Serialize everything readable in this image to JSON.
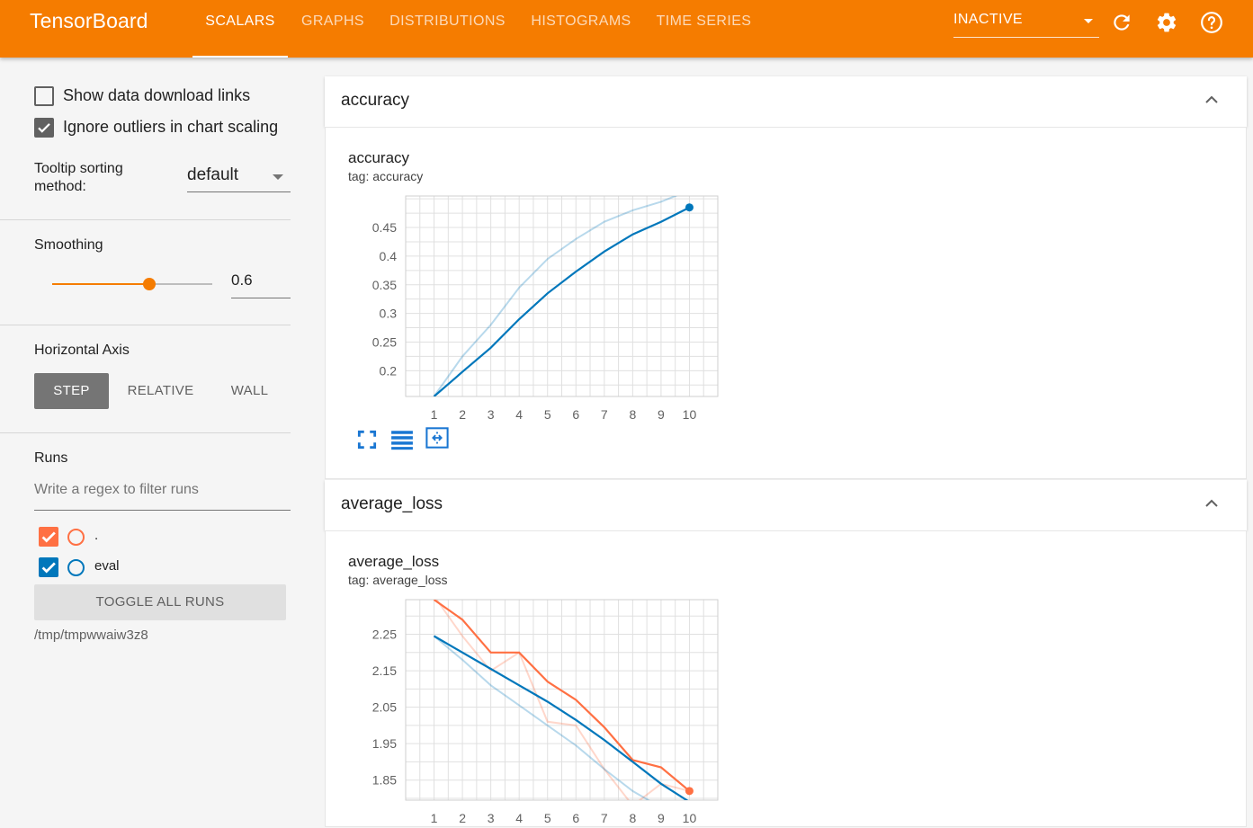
{
  "app": {
    "brand": "TensorBoard",
    "tabs": [
      {
        "label": "SCALARS",
        "active": true
      },
      {
        "label": "GRAPHS",
        "active": false
      },
      {
        "label": "DISTRIBUTIONS",
        "active": false
      },
      {
        "label": "HISTOGRAMS",
        "active": false
      },
      {
        "label": "TIME SERIES",
        "active": false
      }
    ],
    "status": "INACTIVE",
    "icons": [
      "refresh-icon",
      "settings-icon",
      "help-icon"
    ],
    "accent_color": "#f57c00"
  },
  "sidebar": {
    "show_download_links": {
      "label": "Show data download links",
      "checked": false
    },
    "ignore_outliers": {
      "label": "Ignore outliers in chart scaling",
      "checked": true
    },
    "tooltip_sorting": {
      "label": "Tooltip sorting method:",
      "value": "default"
    },
    "smoothing": {
      "label": "Smoothing",
      "value": "0.6",
      "fraction": 0.6
    },
    "horizontal_axis": {
      "label": "Horizontal Axis",
      "options": [
        "STEP",
        "RELATIVE",
        "WALL"
      ],
      "selected": "STEP"
    },
    "runs": {
      "label": "Runs",
      "filter_placeholder": "Write a regex to filter runs",
      "items": [
        {
          "name": ".",
          "checked": true,
          "color": "#ff7043"
        },
        {
          "name": "eval",
          "checked": true,
          "color": "#0077bb"
        }
      ],
      "toggle_all_label": "TOGGLE ALL RUNS",
      "logdir": "/tmp/tmpwwaiw3z8"
    }
  },
  "panels": [
    {
      "header": "accuracy",
      "card_title": "accuracy",
      "card_tag": "tag: accuracy",
      "tools": [
        "fit-domain-icon",
        "data-table-icon",
        "toggle-log-scale-icon"
      ]
    },
    {
      "header": "average_loss",
      "card_title": "average_loss",
      "card_tag": "tag: average_loss"
    }
  ],
  "chart_data": [
    {
      "type": "line",
      "title": "accuracy",
      "x": [
        1,
        2,
        3,
        4,
        5,
        6,
        7,
        8,
        9,
        10
      ],
      "xticks": [
        "1",
        "2",
        "3",
        "4",
        "5",
        "6",
        "7",
        "8",
        "9",
        "10"
      ],
      "yticks": [
        "0.2",
        "0.25",
        "0.3",
        "0.35",
        "0.4",
        "0.45"
      ],
      "xlim": [
        0,
        11
      ],
      "ylim": [
        0.155,
        0.505
      ],
      "grid": true,
      "series": [
        {
          "run": "eval",
          "color": "#0077bb",
          "kind": "raw",
          "values": [
            0.155,
            0.225,
            0.28,
            0.345,
            0.395,
            0.43,
            0.46,
            0.48,
            0.495,
            0.515
          ]
        },
        {
          "run": "eval",
          "color": "#0077bb",
          "kind": "smoothed",
          "values": [
            0.155,
            0.198,
            0.24,
            0.29,
            0.335,
            0.373,
            0.408,
            0.438,
            0.46,
            0.485
          ]
        }
      ]
    },
    {
      "type": "line",
      "title": "average_loss",
      "x": [
        1,
        2,
        3,
        4,
        5,
        6,
        7,
        8,
        9,
        10
      ],
      "xticks": [
        "1",
        "2",
        "3",
        "4",
        "5",
        "6",
        "7",
        "8",
        "9",
        "10"
      ],
      "yticks": [
        "1.85",
        "1.95",
        "2.05",
        "2.15",
        "2.25"
      ],
      "xlim": [
        0,
        11
      ],
      "ylim": [
        1.795,
        2.345
      ],
      "grid": true,
      "series": [
        {
          "run": ".",
          "color": "#ff7043",
          "kind": "raw",
          "values": [
            2.355,
            2.245,
            2.15,
            2.2,
            2.01,
            2.0,
            1.88,
            1.78,
            1.84,
            1.82
          ]
        },
        {
          "run": ".",
          "color": "#ff7043",
          "kind": "smoothed",
          "values": [
            2.345,
            2.29,
            2.2,
            2.2,
            2.12,
            2.07,
            1.995,
            1.905,
            1.885,
            1.82
          ]
        },
        {
          "run": "eval",
          "color": "#0077bb",
          "kind": "raw",
          "values": [
            2.245,
            2.18,
            2.11,
            2.055,
            2.0,
            1.945,
            1.88,
            1.82,
            1.775,
            1.74
          ]
        },
        {
          "run": "eval",
          "color": "#0077bb",
          "kind": "smoothed",
          "values": [
            2.245,
            2.2,
            2.155,
            2.11,
            2.065,
            2.015,
            1.96,
            1.9,
            1.84,
            1.79
          ]
        }
      ]
    }
  ]
}
